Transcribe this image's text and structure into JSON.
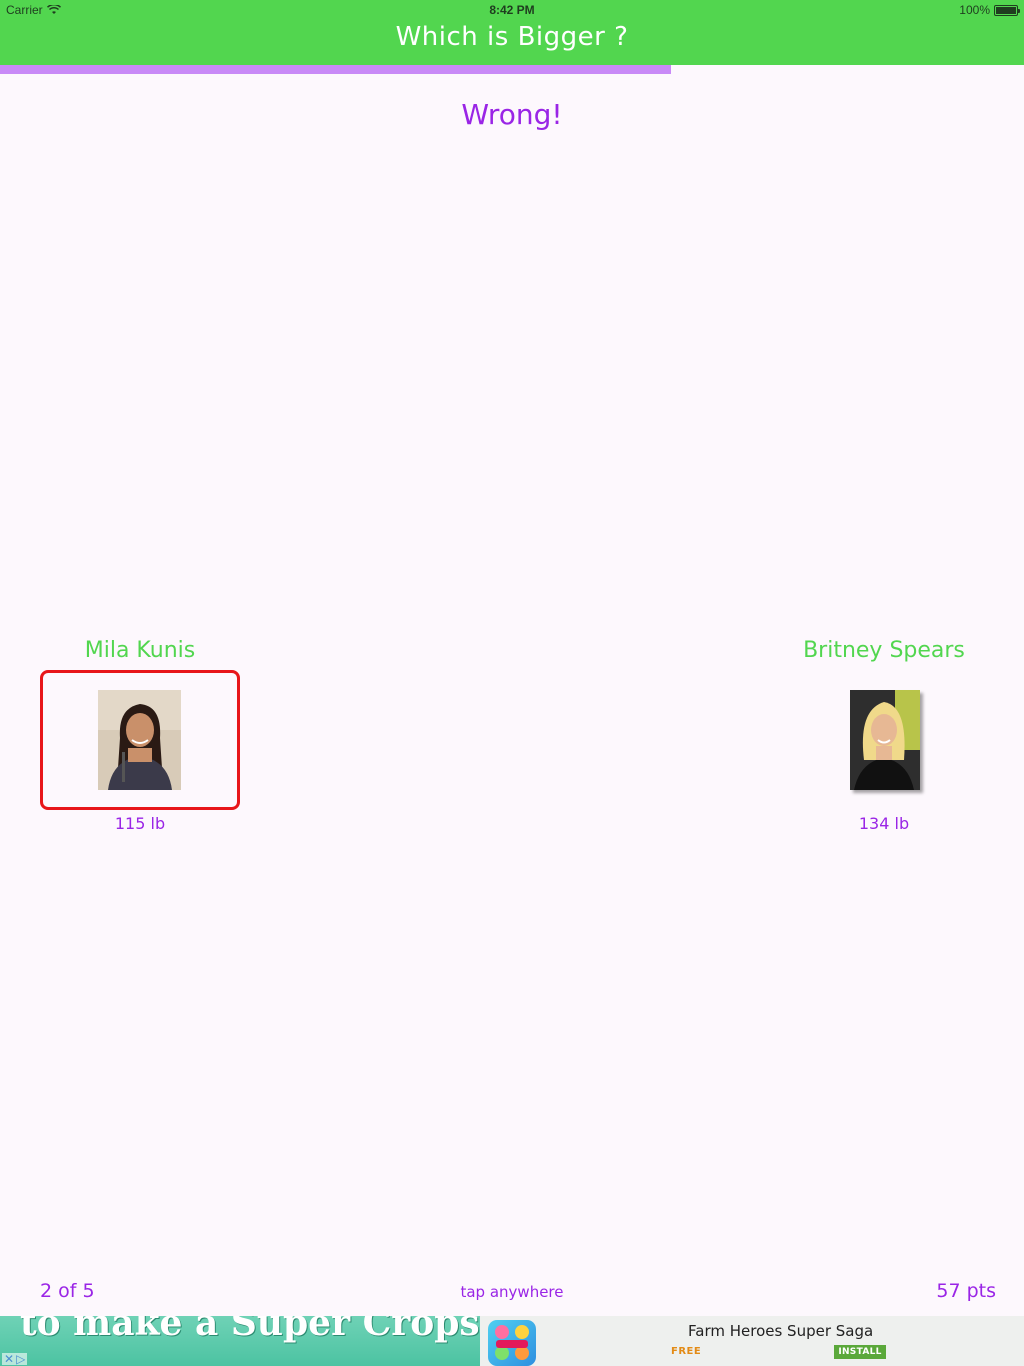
{
  "status_bar": {
    "carrier": "Carrier",
    "time": "8:42 PM",
    "battery": "100%"
  },
  "header": {
    "title": "Which is Bigger ?"
  },
  "progress": {
    "fraction": 0.655
  },
  "result": {
    "text": "Wrong!"
  },
  "left": {
    "name": "Mila Kunis",
    "weight": "115 lb",
    "selected": true
  },
  "right": {
    "name": "Britney Spears",
    "weight": "134 lb"
  },
  "footer": {
    "counter": "2 of 5",
    "hint": "tap anywhere",
    "points": "57 pts"
  },
  "ad": {
    "banner_text": "to make a Super Cropsie",
    "app_name": "Farm Heroes Super Saga",
    "price": "FREE",
    "install": "INSTALL"
  },
  "colors": {
    "header": "#52d64f",
    "accent": "#9a25e6",
    "progress": "#c98af7",
    "selection": "#e8161a",
    "background": "#fdf8fd"
  }
}
